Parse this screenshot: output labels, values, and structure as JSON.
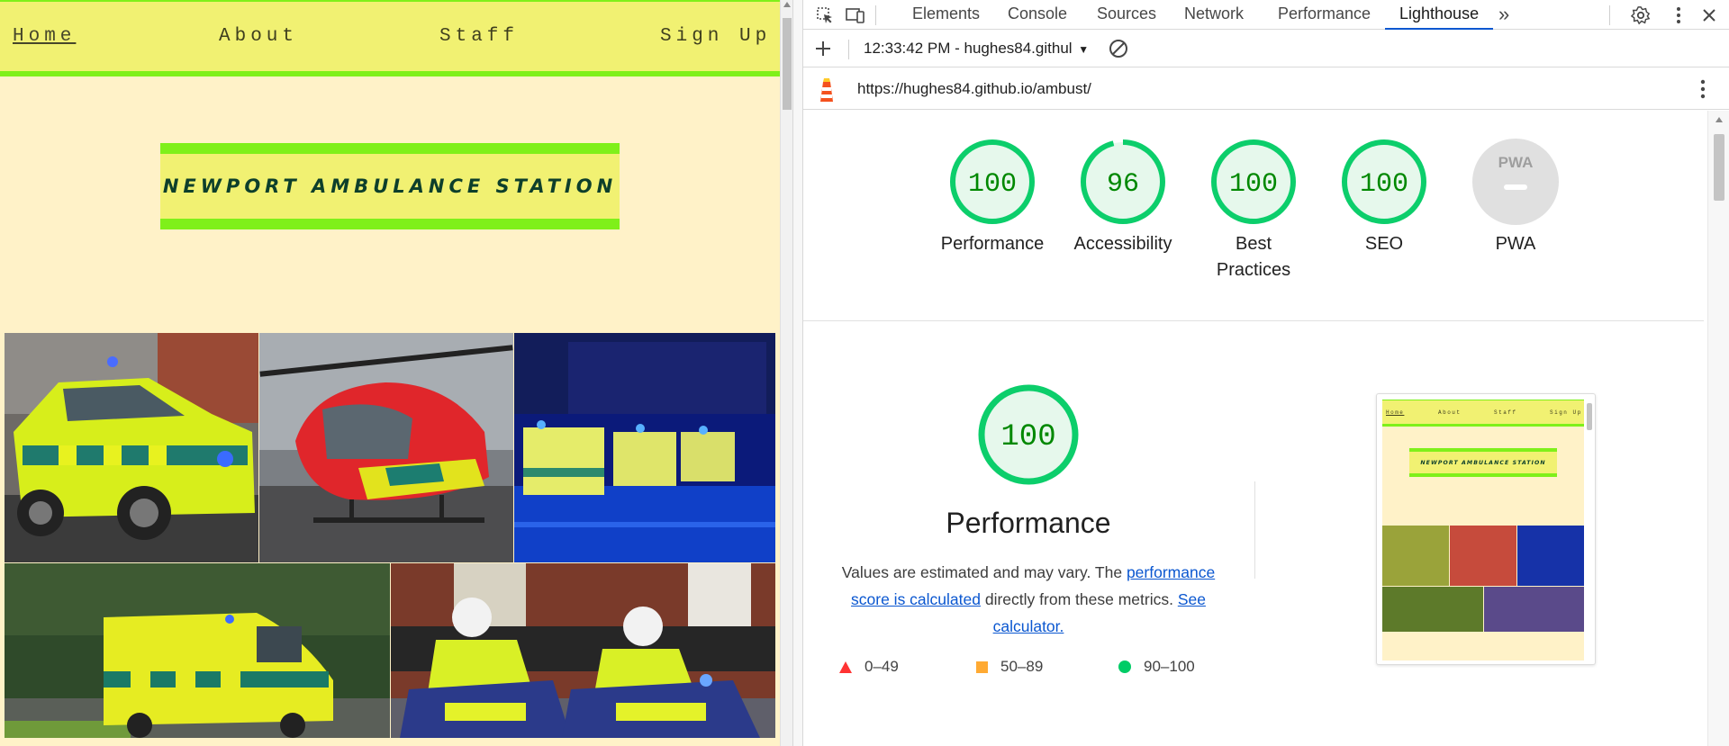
{
  "site": {
    "nav": [
      {
        "label": "Home",
        "active": true
      },
      {
        "label": "About",
        "active": false
      },
      {
        "label": "Staff",
        "active": false
      },
      {
        "label": "Sign Up",
        "active": false
      }
    ],
    "banner_title": "NEWPORT AMBULANCE STATION",
    "colors": {
      "nav_bg": "#f1f172",
      "accent_green": "#7ff01a",
      "page_bg": "#fff2c8",
      "title_text": "#0d3f2b"
    },
    "gallery": [
      {
        "subject": "ambulance rapid response car"
      },
      {
        "subject": "red air ambulance helicopter"
      },
      {
        "subject": "ambulances at night with blue lights"
      },
      {
        "subject": "paramedic unit van"
      },
      {
        "subject": "paramedic motorcycles"
      }
    ]
  },
  "devtools": {
    "toolbar_icons": [
      "inspect-element-icon",
      "device-toolbar-icon"
    ],
    "tabs": [
      {
        "label": "Elements",
        "selected": false
      },
      {
        "label": "Console",
        "selected": false
      },
      {
        "label": "Sources",
        "selected": false
      },
      {
        "label": "Network",
        "selected": false
      },
      {
        "label": "Performance",
        "selected": false
      },
      {
        "label": "Lighthouse",
        "selected": true
      }
    ],
    "more_tabs": "»",
    "lighthouse": {
      "report_time": "12:33:42 PM - hughes84.githul",
      "url": "https://hughes84.github.io/ambust/",
      "scores": [
        {
          "label": "Performance",
          "score": "100",
          "value": 100
        },
        {
          "label": "Accessibility",
          "score": "96",
          "value": 96
        },
        {
          "label": "Best",
          "label2": "Practices",
          "score": "100",
          "value": 100
        },
        {
          "label": "SEO",
          "score": "100",
          "value": 100
        },
        {
          "label": "PWA",
          "score": "PWA",
          "value": null
        }
      ],
      "performance": {
        "score": "100",
        "value": 100,
        "title": "Performance",
        "desc_prefix": "Values are estimated and may vary. The ",
        "link1": "performance score is calculated",
        "desc_mid": " directly from these metrics. ",
        "link2": "See calculator."
      },
      "legend": [
        {
          "range": "0–49",
          "color": "#f33",
          "shape": "triangle"
        },
        {
          "range": "50–89",
          "color": "#fa3",
          "shape": "square"
        },
        {
          "range": "90–100",
          "color": "#0c6",
          "shape": "circle"
        }
      ],
      "colors": {
        "pass_green": "#0cce6b",
        "pass_fill": "#e6f8ec",
        "pass_text": "#008800",
        "pwa_gray": "#e0e0e0"
      }
    }
  }
}
